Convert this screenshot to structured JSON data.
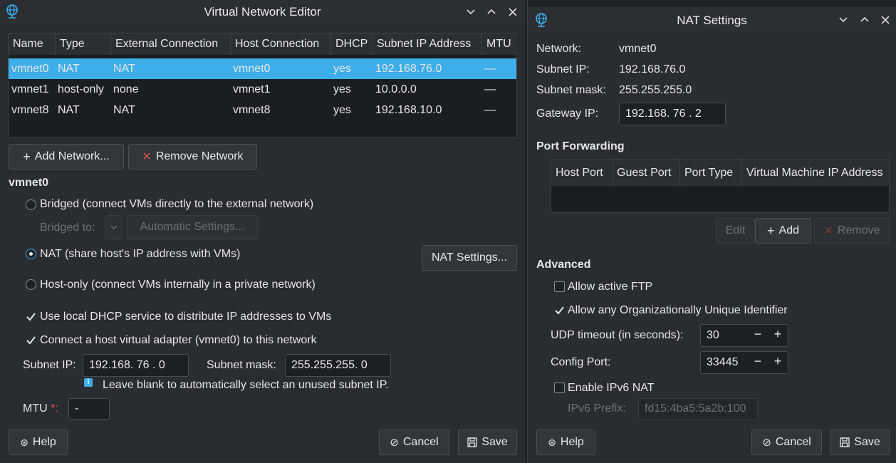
{
  "vne": {
    "title": "Virtual Network Editor",
    "columns": [
      "Name",
      "Type",
      "External Connection",
      "Host Connection",
      "DHCP",
      "Subnet IP Address",
      "MTU"
    ],
    "rows": [
      [
        "vmnet0",
        "NAT",
        "NAT",
        "vmnet0",
        "yes",
        "192.168.76.0",
        "—"
      ],
      [
        "vmnet1",
        "host-only",
        "none",
        "vmnet1",
        "yes",
        "10.0.0.0",
        "—"
      ],
      [
        "vmnet8",
        "NAT",
        "NAT",
        "vmnet8",
        "yes",
        "192.168.10.0",
        "—"
      ]
    ],
    "add_network": "Add Network...",
    "remove_network": "Remove Network",
    "section_title": "vmnet0",
    "bridged_label": "Bridged (connect VMs directly to the external network)",
    "bridged_to_label": "Bridged to:",
    "automatic_settings": "Automatic Settings...",
    "nat_label": "NAT (share host's IP address with VMs)",
    "nat_settings_button": "NAT Settings...",
    "hostonly_label": "Host-only (connect VMs internally in a private network)",
    "dhcp_label": "Use local DHCP service to distribute IP addresses to VMs",
    "adapter_label": "Connect a host virtual adapter (vmnet0) to this network",
    "subnet_ip_label": "Subnet IP:",
    "subnet_ip_value": "192.168. 76 .  0",
    "subnet_mask_label": "Subnet mask:",
    "subnet_mask_value": "255.255.255.  0",
    "hint": "Leave blank to automatically select an unused subnet IP.",
    "mtu_label": "MTU",
    "mtu_required": "*:",
    "mtu_value": "-",
    "help": "Help",
    "cancel": "Cancel",
    "save": "Save"
  },
  "nat": {
    "title": "NAT Settings",
    "network_label": "Network:",
    "network_value": "vmnet0",
    "subnet_ip_label": "Subnet IP:",
    "subnet_ip_value": "192.168.76.0",
    "subnet_mask_label": "Subnet mask:",
    "subnet_mask_value": "255.255.255.0",
    "gateway_label": "Gateway IP:",
    "gateway_value": "192.168. 76 .  2",
    "port_forwarding_title": "Port Forwarding",
    "pf_columns": [
      "Host Port",
      "Guest Port",
      "Port Type",
      "Virtual Machine IP Address"
    ],
    "edit": "Edit",
    "add": "Add",
    "remove": "Remove",
    "advanced_title": "Advanced",
    "allow_ftp": "Allow active FTP",
    "allow_oui": "Allow any Organizationally Unique Identifier",
    "udp_label": "UDP timeout (in seconds):",
    "udp_value": "30",
    "config_port_label": "Config Port:",
    "config_port_value": "33445",
    "ipv6_label": "Enable IPv6 NAT",
    "ipv6_prefix_label": "IPv6 Prefix:",
    "ipv6_prefix_value": "fd15:4ba5:5a2b:100",
    "help": "Help",
    "cancel": "Cancel",
    "save": "Save"
  },
  "colors": {
    "selection": "#3daee9",
    "window_bg": "#292c30",
    "required": "#e04a4a",
    "remove_x": "#d9534f",
    "info": "#3daee9"
  }
}
